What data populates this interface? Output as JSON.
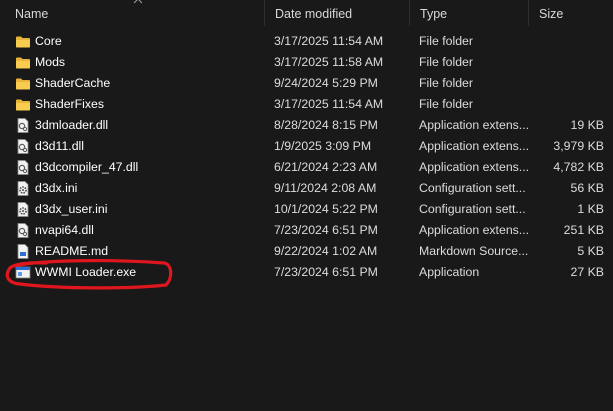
{
  "columns": {
    "name": "Name",
    "date_modified": "Date modified",
    "type": "Type",
    "size": "Size"
  },
  "sort": {
    "column": "name",
    "icon": "sort-up-icon"
  },
  "files": [
    {
      "name": "Core",
      "date": "3/17/2025 11:54 AM",
      "type": "File folder",
      "size": "",
      "icon": "folder-icon"
    },
    {
      "name": "Mods",
      "date": "3/17/2025 11:58 AM",
      "type": "File folder",
      "size": "",
      "icon": "folder-icon"
    },
    {
      "name": "ShaderCache",
      "date": "9/24/2024 5:29 PM",
      "type": "File folder",
      "size": "",
      "icon": "folder-icon"
    },
    {
      "name": "ShaderFixes",
      "date": "3/17/2025 11:54 AM",
      "type": "File folder",
      "size": "",
      "icon": "folder-icon"
    },
    {
      "name": "3dmloader.dll",
      "date": "8/28/2024 8:15 PM",
      "type": "Application extens...",
      "size": "19 KB",
      "icon": "dll-file-icon"
    },
    {
      "name": "d3d11.dll",
      "date": "1/9/2025 3:09 PM",
      "type": "Application extens...",
      "size": "3,979 KB",
      "icon": "dll-file-icon"
    },
    {
      "name": "d3dcompiler_47.dll",
      "date": "6/21/2024 2:23 AM",
      "type": "Application extens...",
      "size": "4,782 KB",
      "icon": "dll-file-icon"
    },
    {
      "name": "d3dx.ini",
      "date": "9/11/2024 2:08 AM",
      "type": "Configuration sett...",
      "size": "56 KB",
      "icon": "ini-file-icon"
    },
    {
      "name": "d3dx_user.ini",
      "date": "10/1/2024 5:22 PM",
      "type": "Configuration sett...",
      "size": "1 KB",
      "icon": "ini-file-icon"
    },
    {
      "name": "nvapi64.dll",
      "date": "7/23/2024 6:51 PM",
      "type": "Application extens...",
      "size": "251 KB",
      "icon": "dll-file-icon"
    },
    {
      "name": "README.md",
      "date": "9/22/2024 1:02 AM",
      "type": "Markdown Source...",
      "size": "5 KB",
      "icon": "markdown-file-icon"
    },
    {
      "name": "WWMI Loader.exe",
      "date": "7/23/2024 6:51 PM",
      "type": "Application",
      "size": "27 KB",
      "icon": "exe-file-icon"
    }
  ],
  "colors": {
    "background": "#191919",
    "text": "#ffffff",
    "header_text": "#d9d9d9",
    "folder": "#f6c644",
    "annotation": "#e0161e"
  }
}
